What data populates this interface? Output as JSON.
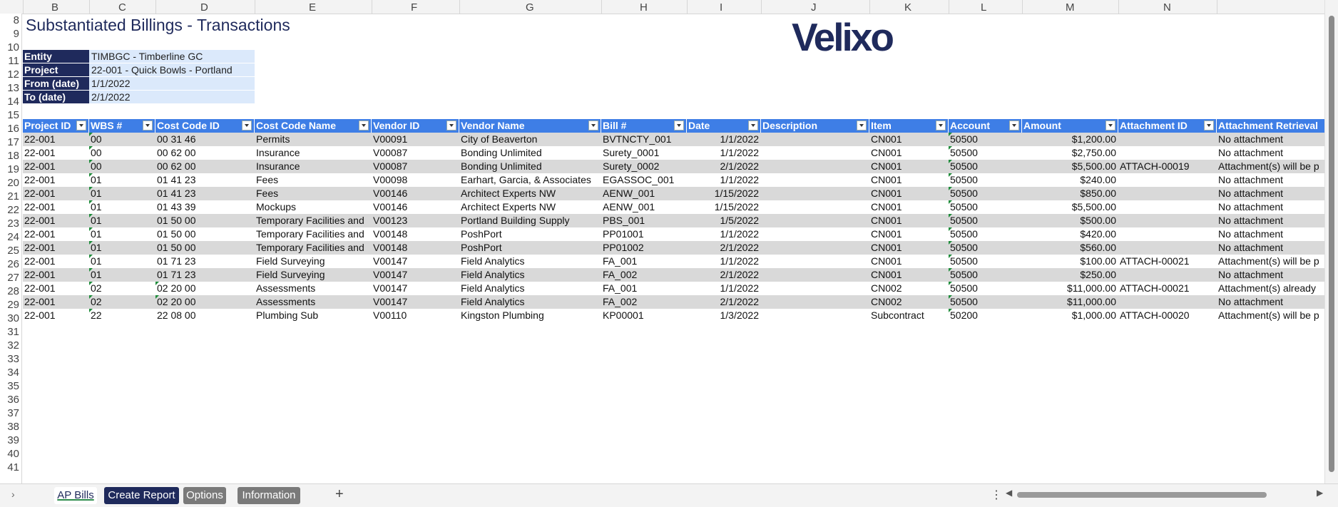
{
  "columns": [
    "B",
    "C",
    "D",
    "E",
    "F",
    "G",
    "H",
    "I",
    "J",
    "K",
    "L",
    "M",
    "N"
  ],
  "rows": [
    "8",
    "9",
    "10",
    "11",
    "12",
    "13",
    "14",
    "15",
    "16",
    "17",
    "18",
    "19",
    "20",
    "21",
    "22",
    "23",
    "24",
    "25",
    "26",
    "27",
    "28",
    "29",
    "30",
    "31",
    "32",
    "33",
    "34",
    "35",
    "36",
    "37",
    "38",
    "39",
    "40",
    "41"
  ],
  "title": "Substantiated Billings - Transactions",
  "logo_text": "Velixo",
  "params": [
    {
      "label": "Entity",
      "value": "TIMBGC - Timberline GC"
    },
    {
      "label": "Project",
      "value": "22-001 - Quick Bowls - Portland"
    },
    {
      "label": "From (date)",
      "value": "1/1/2022"
    },
    {
      "label": "To (date)",
      "value": "2/1/2022"
    }
  ],
  "table": {
    "headers": [
      "Project ID",
      "WBS #",
      "Cost Code ID",
      "Cost Code Name",
      "Vendor ID",
      "Vendor Name",
      "Bill #",
      "Date",
      "Description",
      "Item",
      "Account",
      "Amount",
      "Attachment ID",
      "Attachment Retrieval"
    ],
    "rows": [
      [
        "22-001",
        "00",
        "00 31 46",
        "Permits",
        "V00091",
        "City of Beaverton",
        "BVTNCTY_001",
        "1/1/2022",
        "",
        "CN001",
        "50500",
        "$1,200.00",
        "",
        "No attachment"
      ],
      [
        "22-001",
        "00",
        "00 62 00",
        "Insurance",
        "V00087",
        "Bonding Unlimited",
        "Surety_0001",
        "1/1/2022",
        "",
        "CN001",
        "50500",
        "$2,750.00",
        "",
        "No attachment"
      ],
      [
        "22-001",
        "00",
        "00 62 00",
        "Insurance",
        "V00087",
        "Bonding Unlimited",
        "Surety_0002",
        "2/1/2022",
        "",
        "CN001",
        "50500",
        "$5,500.00",
        "ATTACH-00019",
        "Attachment(s) will be p"
      ],
      [
        "22-001",
        "01",
        "01 41 23",
        "Fees",
        "V00098",
        "Earhart, Garcia, & Associates",
        "EGASSOC_001",
        "1/1/2022",
        "",
        "CN001",
        "50500",
        "$240.00",
        "",
        "No attachment"
      ],
      [
        "22-001",
        "01",
        "01 41 23",
        "Fees",
        "V00146",
        "Architect Experts NW",
        "AENW_001",
        "1/15/2022",
        "",
        "CN001",
        "50500",
        "$850.00",
        "",
        "No attachment"
      ],
      [
        "22-001",
        "01",
        "01 43 39",
        "Mockups",
        "V00146",
        "Architect Experts NW",
        "AENW_001",
        "1/15/2022",
        "",
        "CN001",
        "50500",
        "$5,500.00",
        "",
        "No attachment"
      ],
      [
        "22-001",
        "01",
        "01 50 00",
        "Temporary Facilities and",
        "V00123",
        "Portland Building Supply",
        "PBS_001",
        "1/5/2022",
        "",
        "CN001",
        "50500",
        "$500.00",
        "",
        "No attachment"
      ],
      [
        "22-001",
        "01",
        "01 50 00",
        "Temporary Facilities and",
        "V00148",
        "PoshPort",
        "PP01001",
        "1/1/2022",
        "",
        "CN001",
        "50500",
        "$420.00",
        "",
        "No attachment"
      ],
      [
        "22-001",
        "01",
        "01 50 00",
        "Temporary Facilities and",
        "V00148",
        "PoshPort",
        "PP01002",
        "2/1/2022",
        "",
        "CN001",
        "50500",
        "$560.00",
        "",
        "No attachment"
      ],
      [
        "22-001",
        "01",
        "01 71 23",
        "Field Surveying",
        "V00147",
        "Field Analytics",
        "FA_001",
        "1/1/2022",
        "",
        "CN001",
        "50500",
        "$100.00",
        "ATTACH-00021",
        "Attachment(s) will be p"
      ],
      [
        "22-001",
        "01",
        "01 71 23",
        "Field Surveying",
        "V00147",
        "Field Analytics",
        "FA_002",
        "2/1/2022",
        "",
        "CN001",
        "50500",
        "$250.00",
        "",
        "No attachment"
      ],
      [
        "22-001",
        "02",
        "02 20 00",
        "Assessments",
        "V00147",
        "Field Analytics",
        "FA_001",
        "1/1/2022",
        "",
        "CN002",
        "50500",
        "$11,000.00",
        "ATTACH-00021",
        "Attachment(s) already"
      ],
      [
        "22-001",
        "02",
        "02 20 00",
        "Assessments",
        "V00147",
        "Field Analytics",
        "FA_002",
        "2/1/2022",
        "",
        "CN002",
        "50500",
        "$11,000.00",
        "",
        "No attachment"
      ],
      [
        "22-001",
        "22",
        "22 08 00",
        "Plumbing Sub",
        "V00110",
        "Kingston Plumbing",
        "KP00001",
        "1/3/2022",
        "",
        "Subcontract",
        "50200",
        "$1,000.00",
        "ATTACH-00020",
        "Attachment(s) will be p"
      ]
    ]
  },
  "tabs": [
    {
      "label": "AP Bills",
      "active": true
    },
    {
      "label": "Create Report",
      "color": "#1f2a5c"
    },
    {
      "label": "Options",
      "color": "#7a7a7a"
    },
    {
      "label": "Information",
      "color": "#7a7a7a"
    }
  ],
  "add_sheet_label": "+",
  "colors": {
    "header_blue": "#3e7ee6",
    "navy": "#1f2a5c",
    "param_fill": "#dbe9fb",
    "band": "#d9d9d9"
  }
}
